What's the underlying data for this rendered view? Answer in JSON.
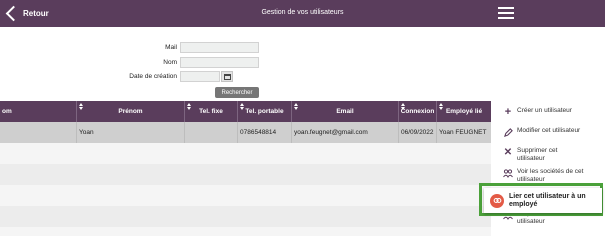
{
  "header": {
    "back_label": "Retour",
    "title": "Gestion de vos utilisateurs"
  },
  "search": {
    "mail_label": "Mail",
    "mail_value": "",
    "nom_label": "Nom",
    "nom_value": "",
    "date_label": "Date de création",
    "date_value": "",
    "button_label": "Rechercher"
  },
  "table": {
    "columns": [
      "om",
      "Prénom",
      "Tel. fixe",
      "Tel. portable",
      "Email",
      "Connexion",
      "Employé lié"
    ],
    "rows": [
      {
        "nom": "",
        "prenom": "Yoan",
        "tel_fixe": "",
        "tel_portable": "0786548814",
        "email": "yoan.feugnet@gmail.com",
        "connexion": "06/09/2022",
        "employe_lie": "Yoan FEUGNET"
      }
    ]
  },
  "actions": {
    "create": "Créer un utilisateur",
    "modify": "Modifier cet utilisateur",
    "delete": "Supprimer cet utilisateur",
    "view_companies": "Voir les sociétés de cet utilisateur",
    "link_employee": "Lier cet utilisateur à un employé",
    "unlink": "Ne plus lier cet utilisateur"
  },
  "colors": {
    "brand": "#5a3d5c",
    "highlight": "#4ba13a",
    "link_icon": "#e35a46"
  },
  "icons": {
    "back": "chevron-left-icon",
    "menu": "hamburger-icon",
    "calendar": "calendar-icon",
    "create": "plus-icon",
    "modify": "pencil-icon",
    "delete": "x-icon",
    "view_companies": "users-icon",
    "link_employee": "link-icon",
    "unlink": "users-icon"
  }
}
